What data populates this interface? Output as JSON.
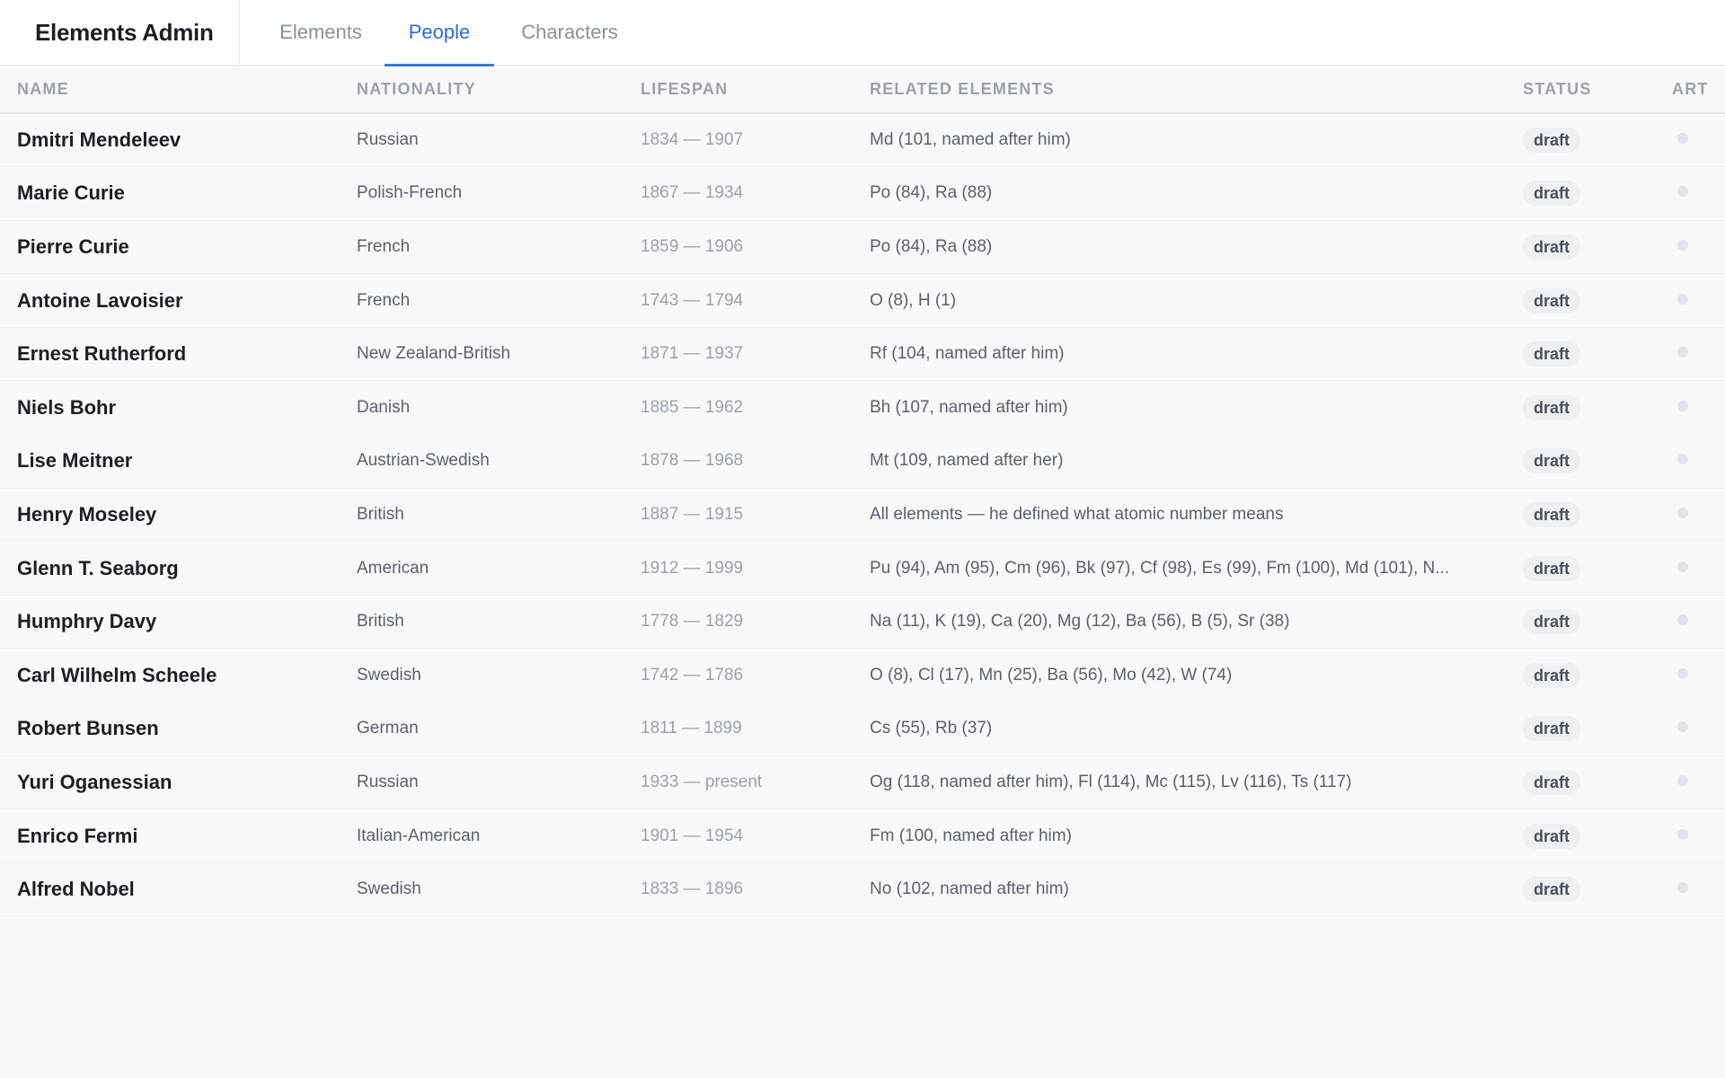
{
  "app": {
    "title": "Elements Admin"
  },
  "tabs": [
    {
      "label": "Elements",
      "active": false
    },
    {
      "label": "People",
      "active": true
    },
    {
      "label": "Characters",
      "active": false
    }
  ],
  "colors": {
    "accent": "#2c6bd6",
    "tab_underline": "#3a78e0",
    "badge_bg": "#eef0f3",
    "art_dot": "#e1e4e8"
  },
  "table": {
    "headers": {
      "name": "NAME",
      "nationality": "NATIONALITY",
      "lifespan": "LIFESPAN",
      "related": "RELATED ELEMENTS",
      "status": "STATUS",
      "art": "ART"
    },
    "rows": [
      {
        "name": "Dmitri Mendeleev",
        "nationality": "Russian",
        "lifespan": "1834 — 1907",
        "related": "Md (101, named after him)",
        "status": "draft",
        "art": "empty-dot"
      },
      {
        "name": "Marie Curie",
        "nationality": "Polish-French",
        "lifespan": "1867 — 1934",
        "related": "Po (84), Ra (88)",
        "status": "draft",
        "art": "empty-dot"
      },
      {
        "name": "Pierre Curie",
        "nationality": "French",
        "lifespan": "1859 — 1906",
        "related": "Po (84), Ra (88)",
        "status": "draft",
        "art": "empty-dot"
      },
      {
        "name": "Antoine Lavoisier",
        "nationality": "French",
        "lifespan": "1743 — 1794",
        "related": "O (8), H (1)",
        "status": "draft",
        "art": "empty-dot"
      },
      {
        "name": "Ernest Rutherford",
        "nationality": "New Zealand-British",
        "lifespan": "1871 — 1937",
        "related": "Rf (104, named after him)",
        "status": "draft",
        "art": "empty-dot"
      },
      {
        "name": "Niels Bohr",
        "nationality": "Danish",
        "lifespan": "1885 — 1962",
        "related": "Bh (107, named after him)",
        "status": "draft",
        "art": "empty-dot"
      },
      {
        "name": "Lise Meitner",
        "nationality": "Austrian-Swedish",
        "lifespan": "1878 — 1968",
        "related": "Mt (109, named after her)",
        "status": "draft",
        "art": "empty-dot"
      },
      {
        "name": "Henry Moseley",
        "nationality": "British",
        "lifespan": "1887 — 1915",
        "related": "All elements — he defined what atomic number means",
        "status": "draft",
        "art": "empty-dot"
      },
      {
        "name": "Glenn T. Seaborg",
        "nationality": "American",
        "lifespan": "1912 — 1999",
        "related": "Pu (94), Am (95), Cm (96), Bk (97), Cf (98), Es (99), Fm (100), Md (101), N...",
        "status": "draft",
        "art": "empty-dot"
      },
      {
        "name": "Humphry Davy",
        "nationality": "British",
        "lifespan": "1778 — 1829",
        "related": "Na (11), K (19), Ca (20), Mg (12), Ba (56), B (5), Sr (38)",
        "status": "draft",
        "art": "empty-dot"
      },
      {
        "name": "Carl Wilhelm Scheele",
        "nationality": "Swedish",
        "lifespan": "1742 — 1786",
        "related": "O (8), Cl (17), Mn (25), Ba (56), Mo (42), W (74)",
        "status": "draft",
        "art": "empty-dot"
      },
      {
        "name": "Robert Bunsen",
        "nationality": "German",
        "lifespan": "1811 — 1899",
        "related": "Cs (55), Rb (37)",
        "status": "draft",
        "art": "empty-dot"
      },
      {
        "name": "Yuri Oganessian",
        "nationality": "Russian",
        "lifespan": "1933 — present",
        "related": "Og (118, named after him), Fl (114), Mc (115), Lv (116), Ts (117)",
        "status": "draft",
        "art": "empty-dot"
      },
      {
        "name": "Enrico Fermi",
        "nationality": "Italian-American",
        "lifespan": "1901 — 1954",
        "related": "Fm (100, named after him)",
        "status": "draft",
        "art": "empty-dot"
      },
      {
        "name": "Alfred Nobel",
        "nationality": "Swedish",
        "lifespan": "1833 — 1896",
        "related": "No (102, named after him)",
        "status": "draft",
        "art": "empty-dot"
      }
    ]
  }
}
